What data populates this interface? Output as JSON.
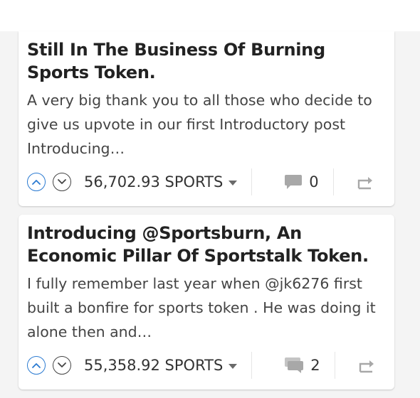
{
  "feed": {
    "posts": [
      {
        "title": "Still In The Business Of Burning Sports Token.",
        "excerpt": "A very big thank you to all those who decide to give us upvote in our first Introductory post Introducing…",
        "payout": "56,702.93 SPORTS",
        "comments": "0",
        "upvoted": true
      },
      {
        "title": "Introducing @Sportsburn, An Economic Pillar Of Sportstalk Token.",
        "excerpt": "I fully remember last year when @jk6276 first built a bonfire for sports token . He was doing it alone then and…",
        "payout": "55,358.92 SPORTS",
        "comments": "2",
        "upvoted": true
      }
    ]
  },
  "icons": {
    "upvote": "chevron-up-circle-icon",
    "downvote": "chevron-down-circle-icon",
    "payout_menu": "caret-down-icon",
    "comments": "comment-bubble-icon",
    "reblog": "reblog-icon"
  },
  "colors": {
    "upvote_active": "#2a7ad1",
    "text_primary": "#222222",
    "text_secondary": "#444444",
    "icon_gray": "#9e9e9e"
  }
}
